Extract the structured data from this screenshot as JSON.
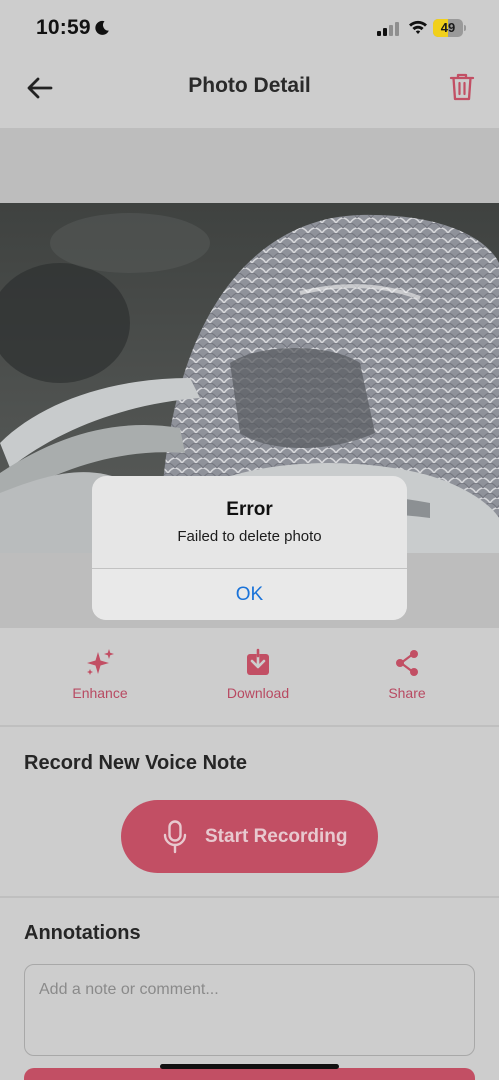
{
  "status_bar": {
    "time": "10:59",
    "battery_level": "49",
    "battery_fraction": 0.49,
    "icons": [
      "moon-icon",
      "cellular-signal-icon",
      "wifi-icon",
      "battery-icon"
    ]
  },
  "header": {
    "title": "Photo Detail",
    "back_icon": "arrow-left-icon",
    "delete_icon": "trash-icon"
  },
  "actions": [
    {
      "label": "Enhance",
      "icon": "sparkles-icon"
    },
    {
      "label": "Download",
      "icon": "download-icon"
    },
    {
      "label": "Share",
      "icon": "share-icon"
    }
  ],
  "voice_note": {
    "title": "Record New Voice Note",
    "button_label": "Start Recording",
    "button_icon": "microphone-icon"
  },
  "annotations": {
    "title": "Annotations",
    "placeholder": "Add a note or comment..."
  },
  "alert": {
    "title": "Error",
    "message": "Failed to delete photo",
    "ok_label": "OK"
  },
  "colors": {
    "accent": "#c24f64",
    "accent_text": "#b84a62",
    "alert_link": "#1a73d9",
    "battery": "#f1d01b"
  }
}
